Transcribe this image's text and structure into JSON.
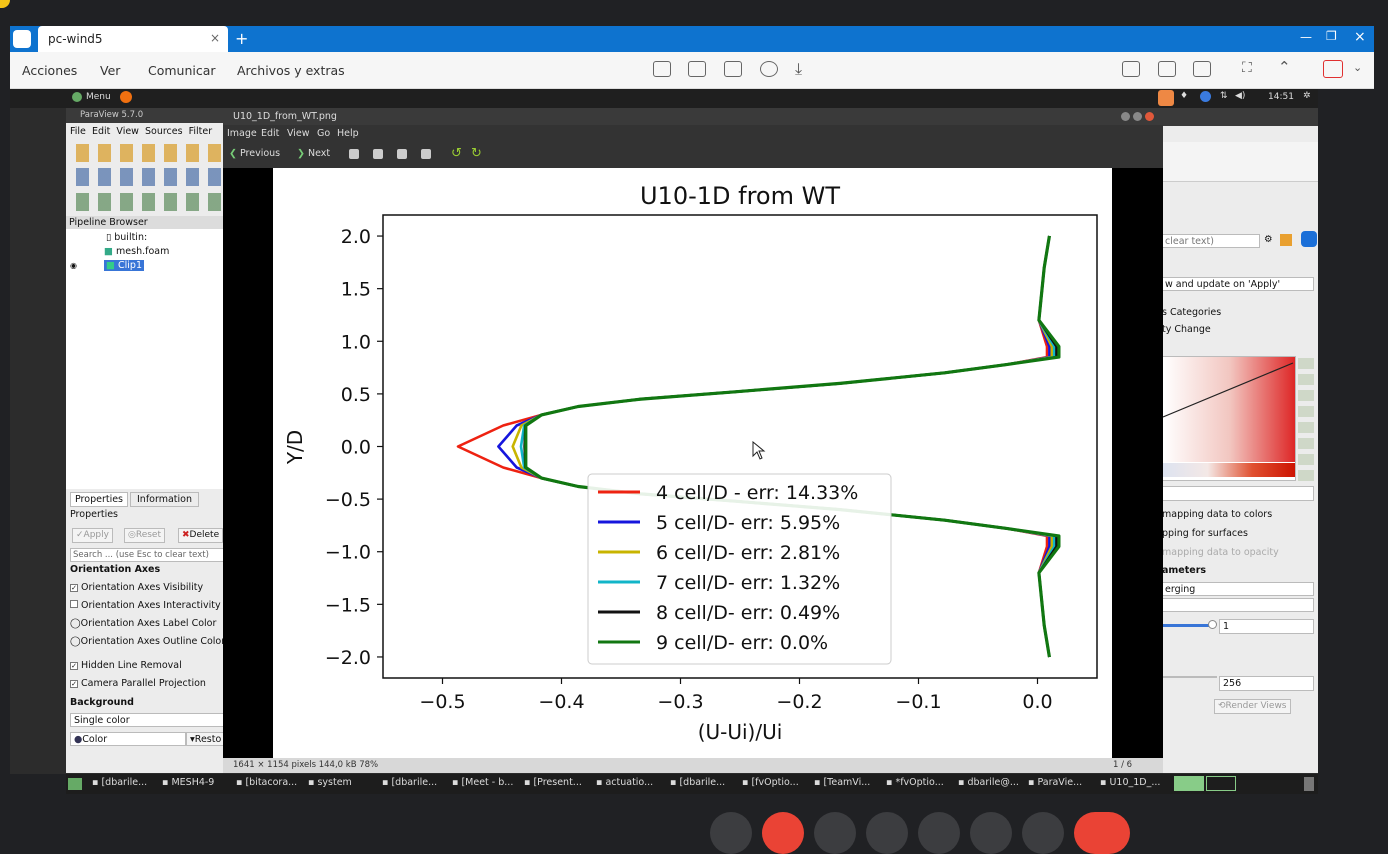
{
  "teamviewer": {
    "tab_title": "pc-wind5",
    "menus": [
      "Acciones",
      "Ver",
      "Comunicar",
      "Archivos y extras"
    ]
  },
  "ubuntu": {
    "menu_label": "Menu",
    "clock": "14:51"
  },
  "paraview_left": {
    "version": "ParaView 5.7.0",
    "menus": [
      "File",
      "Edit",
      "View",
      "Sources",
      "Filter"
    ],
    "pipeline_title": "Pipeline Browser",
    "pipeline_items": [
      "builtin:",
      "mesh.foam",
      "Clip1"
    ],
    "tabs": [
      "Properties",
      "Information"
    ],
    "properties_label": "Properties",
    "apply_label": "Apply",
    "reset_label": "Reset",
    "delete_label": "Delete",
    "search_placeholder": "Search ... (use Esc to clear text)",
    "section_orientation": "Orientation Axes",
    "orientation_items": [
      {
        "label": "Orientation Axes Visibility",
        "checked": true
      },
      {
        "label": "Orientation Axes Interactivity",
        "checked": false
      },
      {
        "label": "Orientation Axes Label Color",
        "checked": false
      },
      {
        "label": "Orientation Axes Outline Color",
        "checked": false
      }
    ],
    "hidden_line": "Hidden Line Removal",
    "camera_parallel": "Camera Parallel Projection",
    "section_background": "Background",
    "background_value": "Single color",
    "color_label": "Color",
    "restore_label": "Resto"
  },
  "paraview_right": {
    "search_placeholder": "clear text)",
    "update_option": "w and update on 'Apply'",
    "categories": "s Categories",
    "change": "ty Change",
    "mapping_colors": "mapping data to colors",
    "mapping_surfaces": "pping for surfaces",
    "mapping_opacity": "mapping data to opacity",
    "parameters": "ameters",
    "colormap_value": "erging",
    "value_1": "1",
    "value_256": "256",
    "render_views": "Render Views"
  },
  "viewer": {
    "title": "U10_1D_from_WT.png",
    "menus": [
      "Image",
      "Edit",
      "View",
      "Go",
      "Help"
    ],
    "previous": "Previous",
    "next": "Next",
    "status_info": "1641 × 1154 pixels  144,0 kB  78%",
    "page_counter": "1 / 6"
  },
  "chart_data": {
    "type": "line",
    "title": "U10-1D from WT",
    "xlabel": "(U-Ui)/Ui",
    "ylabel": "Y/D",
    "xlim": [
      -0.55,
      0.05
    ],
    "ylim": [
      -2.2,
      2.2
    ],
    "xticks": [
      -0.5,
      -0.4,
      -0.3,
      -0.2,
      -0.1,
      0.0
    ],
    "yticks": [
      2.0,
      1.5,
      1.0,
      0.5,
      0.0,
      -0.5,
      -1.0,
      -1.5,
      -2.0
    ],
    "xtick_labels": [
      "−0.5",
      "−0.4",
      "−0.3",
      "−0.2",
      "−0.1",
      "0.0"
    ],
    "ytick_labels": [
      "2.0",
      "1.5",
      "1.0",
      "0.5",
      "0.0",
      "−0.5",
      "−1.0",
      "−1.5",
      "−2.0"
    ],
    "legend_position": "lower-center",
    "series": [
      {
        "name": "4 cell/D - err: 14.33%",
        "color": "#ee2211",
        "min_x": -0.487
      },
      {
        "name": "5 cell/D- err: 5.95%",
        "color": "#1515dd",
        "min_x": -0.453
      },
      {
        "name": "6 cell/D- err: 2.81%",
        "color": "#c8b400",
        "min_x": -0.441
      },
      {
        "name": "7 cell/D- err: 1.32%",
        "color": "#11b5c8",
        "min_x": -0.434
      },
      {
        "name": "8 cell/D- err: 0.49%",
        "color": "#111111",
        "min_x": -0.431
      },
      {
        "name": "9 cell/D- err: 0.0%",
        "color": "#117711",
        "min_x": -0.43
      }
    ]
  },
  "taskbar": {
    "items": [
      "[dbarile...",
      "MESH4-9",
      "[bitacora...",
      "system",
      "[dbarile...",
      "[Meet - b...",
      "[Present...",
      "actuatio...",
      "[dbarile...",
      "[fvOptio...",
      "[TeamVi...",
      "*fvOptio...",
      "dbarile@...",
      "ParaVie...",
      "U10_1D_..."
    ]
  }
}
